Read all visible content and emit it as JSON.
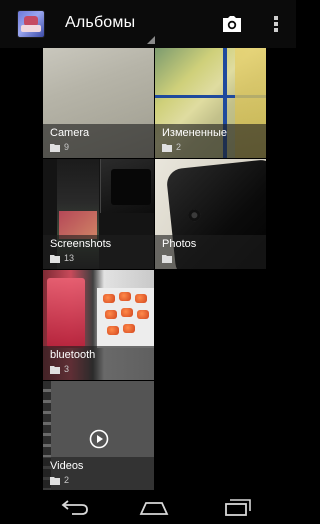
{
  "app": {
    "title": "Альбомы",
    "icon": "gallery-app-icon"
  },
  "actionbar": {
    "camera_icon": "camera-icon",
    "overflow_icon": "overflow-menu-icon"
  },
  "albums": [
    {
      "name": "Camera",
      "count": "9",
      "icon": "folder-icon"
    },
    {
      "name": "Измененные",
      "count": "2",
      "icon": "folder-icon"
    },
    {
      "name": "Screenshots",
      "count": "13",
      "icon": "folder-icon"
    },
    {
      "name": "Photos",
      "count": "",
      "icon": "folder-icon"
    },
    {
      "name": "bluetooth",
      "count": "3",
      "icon": "folder-icon"
    },
    {
      "name": "Videos",
      "count": "2",
      "icon": "folder-icon"
    }
  ],
  "navbar": {
    "back_icon": "back-icon",
    "home_icon": "home-icon",
    "recent_icon": "recent-apps-icon"
  },
  "colors": {
    "background": "#000000",
    "label_overlay": "#1e1e1e",
    "accent_blue": "#1f4a9d"
  }
}
